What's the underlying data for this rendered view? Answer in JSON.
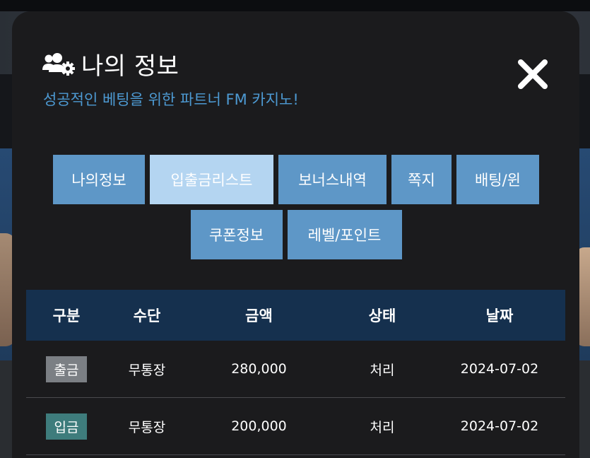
{
  "modal": {
    "title": "나의 정보",
    "subtitle": "성공적인 베팅을 위한 파트너 FM 카지노!",
    "title_icon": "users-gear-icon",
    "close_icon": "close-icon"
  },
  "tabs": [
    {
      "label": "나의정보",
      "active": false
    },
    {
      "label": "입출금리스트",
      "active": true
    },
    {
      "label": "보너스내역",
      "active": false
    },
    {
      "label": "쪽지",
      "active": false
    },
    {
      "label": "배팅/윈",
      "active": false
    },
    {
      "label": "쿠폰정보",
      "active": false
    },
    {
      "label": "레벨/포인트",
      "active": false
    }
  ],
  "table": {
    "headers": [
      "구분",
      "수단",
      "금액",
      "상태",
      "날짜"
    ],
    "rows": [
      {
        "type": "출금",
        "type_color": "#7b7f84",
        "method": "무통장",
        "amount": "280,000",
        "status": "처리",
        "date": "2024-07-02"
      },
      {
        "type": "입금",
        "type_color": "#3e7c7c",
        "method": "무통장",
        "amount": "200,000",
        "status": "처리",
        "date": "2024-07-02"
      }
    ]
  },
  "colors": {
    "accent": "#4d9ad3",
    "tab": "#5e97c7",
    "tab_active": "#b4d5f1",
    "table_header": "#15304e"
  }
}
